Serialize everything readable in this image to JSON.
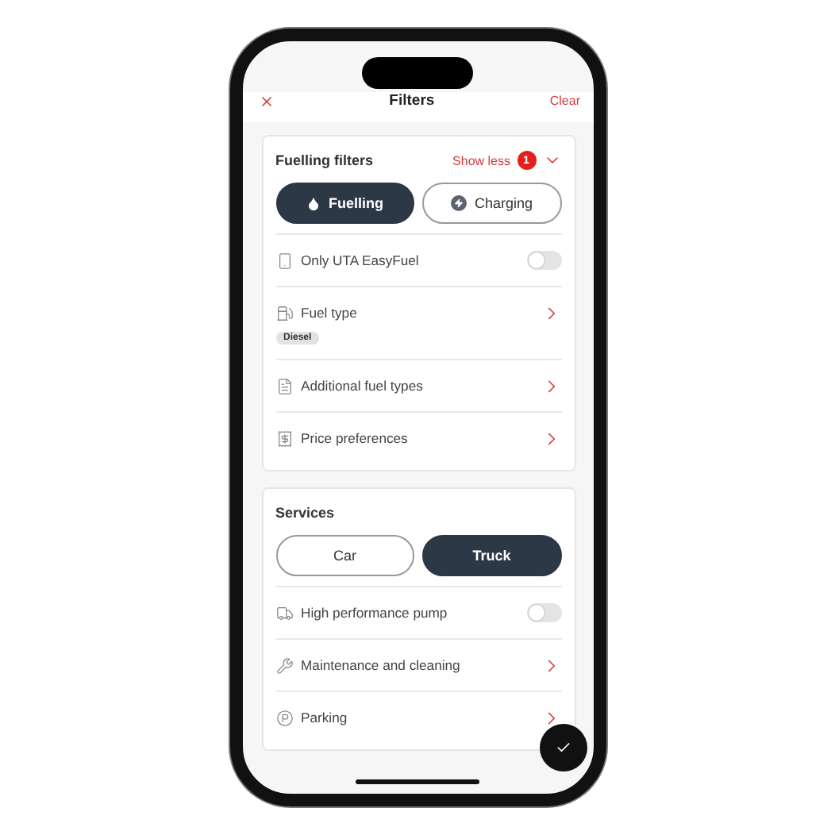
{
  "header": {
    "title": "Filters",
    "action": "Clear"
  },
  "sections": [
    {
      "title": "Fuelling filters",
      "toggle_label": "Show less",
      "badge": "1",
      "expanded": true,
      "segments": [
        {
          "label": "Fuelling",
          "selected": true
        },
        {
          "label": "Charging",
          "selected": false
        }
      ],
      "rows": [
        {
          "kind": "toggle",
          "label": "Only UTA EasyFuel",
          "on": false
        },
        {
          "kind": "link",
          "label": "Fuel type",
          "tags": [
            "Diesel"
          ]
        },
        {
          "kind": "link",
          "label": "Additional fuel types"
        },
        {
          "kind": "link",
          "label": "Price preferences"
        }
      ]
    },
    {
      "title": "Services",
      "segments": [
        {
          "label": "Car",
          "selected": false
        },
        {
          "label": "Truck",
          "selected": true
        }
      ],
      "rows": [
        {
          "kind": "toggle",
          "label": "High performance pump",
          "on": false
        },
        {
          "kind": "link",
          "label": "Maintenance and cleaning"
        },
        {
          "kind": "link",
          "label": "Parking"
        }
      ]
    }
  ]
}
